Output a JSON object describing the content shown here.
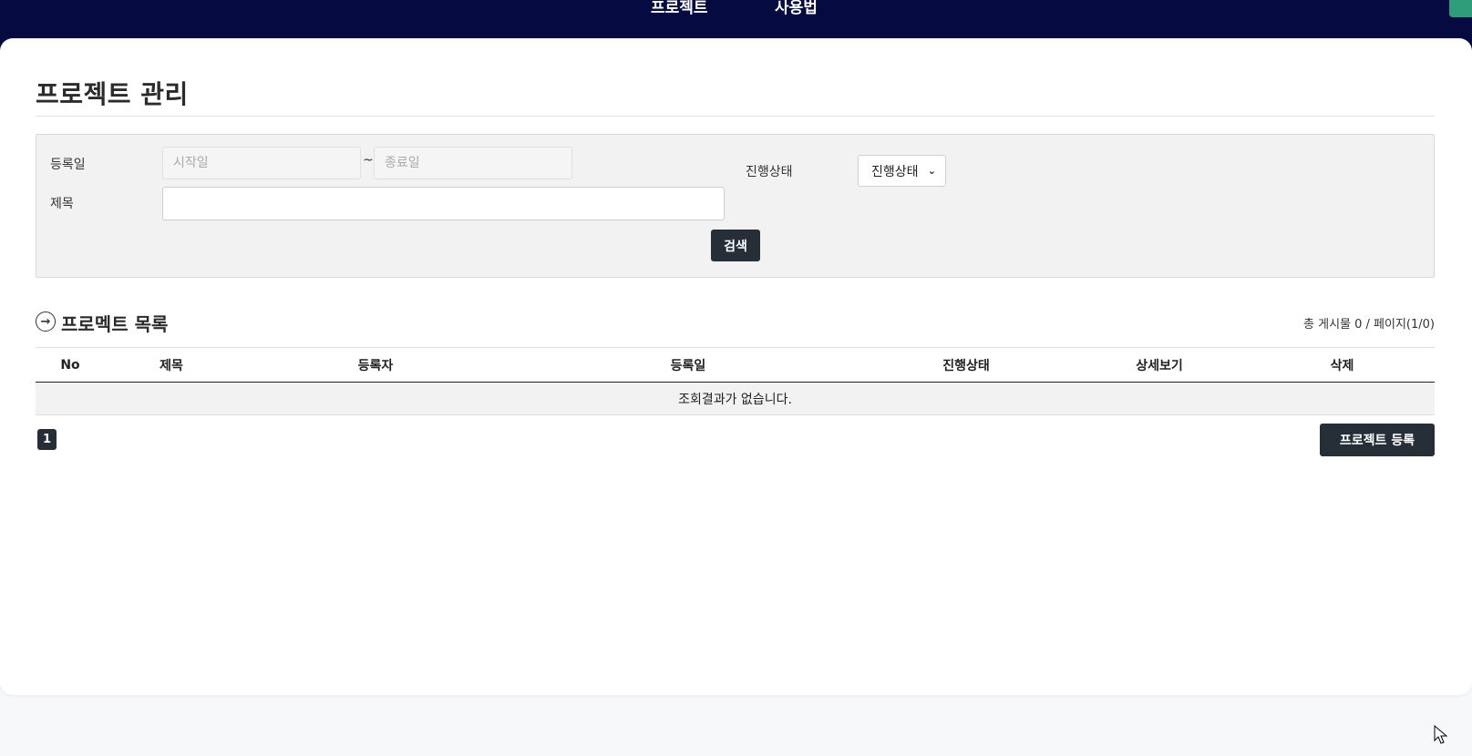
{
  "nav": {
    "items": [
      {
        "label": "프로젝트"
      },
      {
        "label": "사용법"
      }
    ]
  },
  "page": {
    "title": "프로젝트 관리"
  },
  "search": {
    "regdate_label": "등록일",
    "start_placeholder": "시작일",
    "tilde": "~",
    "end_placeholder": "종료일",
    "title_label": "제목",
    "title_value": "",
    "status_label": "진행상태",
    "status_selected": "진행상태",
    "search_button": "검색"
  },
  "list": {
    "title": "프로멕트 목록",
    "count_text": "총 게시물 0 / 페이지(1/0)",
    "columns": [
      "No",
      "제목",
      "등록자",
      "등록일",
      "진행상태",
      "상세보기",
      "삭제"
    ],
    "empty_message": "조회결과가 없습니다."
  },
  "pagination": {
    "current_page": "1"
  },
  "actions": {
    "register_button": "프로젝트 등록"
  },
  "colors": {
    "nav_bg": "#050a40",
    "button_bg": "#262e38",
    "panel_bg": "#f2f2f2",
    "corner_accent": "#2e9e7a"
  }
}
